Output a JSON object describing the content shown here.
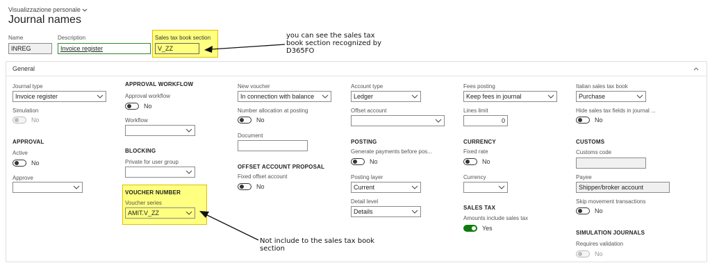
{
  "view_selector": "Visualizzazione personale",
  "page_title": "Journal names",
  "header_fields": {
    "name_label": "Name",
    "name_value": "INREG",
    "description_label": "Description",
    "description_value": "Invoice register",
    "sales_tax_label": "Sales tax book section",
    "sales_tax_value": "V_ZZ"
  },
  "annotations": {
    "top": "you can see the sales tax book section recognized by D365FO",
    "bottom": "Not include to the sales tax book section"
  },
  "section_title": "General",
  "col1": {
    "journal_type_label": "Journal type",
    "journal_type_value": "Invoice register",
    "simulation_label": "Simulation",
    "simulation_value": "No",
    "approval_header": "APPROVAL",
    "active_label": "Active",
    "active_value": "No",
    "approve_label": "Approve",
    "approve_value": ""
  },
  "col2": {
    "approval_workflow_header": "APPROVAL WORKFLOW",
    "approval_workflow_label": "Approval workflow",
    "approval_workflow_value": "No",
    "workflow_label": "Workflow",
    "workflow_value": "",
    "blocking_header": "BLOCKING",
    "private_label": "Private for user group",
    "private_value": "",
    "voucher_number_header": "VOUCHER NUMBER",
    "voucher_series_label": "Voucher series",
    "voucher_series_value": "AMIT.V_ZZ"
  },
  "col3": {
    "new_voucher_label": "New voucher",
    "new_voucher_value": "In connection with balance",
    "number_alloc_label": "Number allocation at posting",
    "number_alloc_value": "No",
    "document_label": "Document",
    "document_value": "",
    "offset_header": "OFFSET ACCOUNT PROPOSAL",
    "fixed_offset_label": "Fixed offset account",
    "fixed_offset_value": "No"
  },
  "col4": {
    "account_type_label": "Account type",
    "account_type_value": "Ledger",
    "offset_account_label": "Offset account",
    "offset_account_value": "",
    "posting_header": "POSTING",
    "generate_payments_label": "Generate payments before pos...",
    "generate_payments_value": "No",
    "posting_layer_label": "Posting layer",
    "posting_layer_value": "Current",
    "detail_level_label": "Detail level",
    "detail_level_value": "Details"
  },
  "col5": {
    "fees_posting_label": "Fees posting",
    "fees_posting_value": "Keep fees in journal",
    "lines_limit_label": "Lines limit",
    "lines_limit_value": "0",
    "currency_header": "CURRENCY",
    "fixed_rate_label": "Fixed rate",
    "fixed_rate_value": "No",
    "currency_label": "Currency",
    "currency_value": "",
    "sales_tax_header": "SALES TAX",
    "amounts_include_label": "Amounts include sales tax",
    "amounts_include_value": "Yes"
  },
  "col6": {
    "italian_book_label": "Italian sales tax book",
    "italian_book_value": "Purchase",
    "hide_fields_label": "Hide sales tax fields in journal ...",
    "hide_fields_value": "No",
    "customs_header": "CUSTOMS",
    "customs_code_label": "Customs code",
    "customs_code_value": "",
    "payee_label": "Payee",
    "payee_value": "Shipper/broker account",
    "skip_movement_label": "Skip movement transactions",
    "skip_movement_value": "No",
    "simulation_journals_header": "SIMULATION JOURNALS",
    "requires_validation_label": "Requires validation",
    "requires_validation_value": "No"
  },
  "colors": {
    "accent_green": "#0f7b0f",
    "highlight_yellow": "#ffff80",
    "input_border": "#8a8a8a"
  }
}
